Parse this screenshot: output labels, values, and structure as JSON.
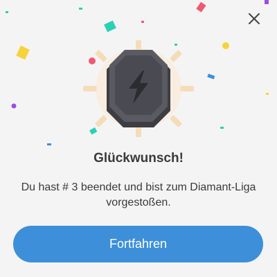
{
  "dialog": {
    "title": "Glückwunsch!",
    "message": "Du hast # 3 beendet und bist zum Diamant-Liga vorgestoßen.",
    "continue_label": "Fortfahren"
  },
  "icons": {
    "close": "close-icon",
    "badge": "league-badge-icon",
    "bolt": "lightning-bolt-icon"
  },
  "colors": {
    "background": "#f4f4f4",
    "button": "#3d8fd9",
    "button_text": "#ffffff",
    "text": "#3a3a3a",
    "badge_dark": "#4a4a50",
    "badge_glow": "#f7c98a"
  }
}
